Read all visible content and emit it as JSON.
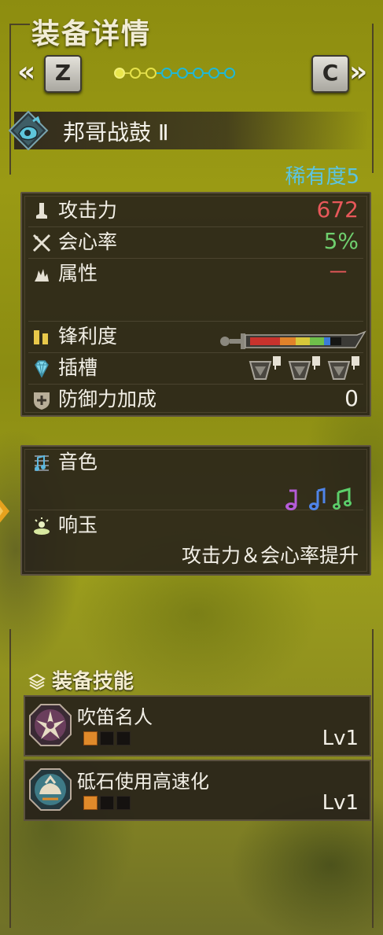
{
  "header": {
    "title": "装备详情",
    "prev_key": "Z",
    "next_key": "C",
    "prev_chevron": "«",
    "next_chevron": "»",
    "page_dots": [
      "filled",
      "yellow",
      "yellow",
      "blue",
      "blue",
      "blue",
      "blue",
      "blue"
    ]
  },
  "weapon": {
    "name": "邦哥战鼓 Ⅱ",
    "icon": "hunting-horn-icon",
    "rarity": "稀有度5"
  },
  "stats": {
    "attack_label": "攻击力",
    "attack_value": "672",
    "affinity_label": "会心率",
    "affinity_value": "5%",
    "element_label": "属性",
    "element_value": "－",
    "sharpness_label": "锋利度",
    "slots_label": "插槽",
    "defense_label": "防御力加成",
    "defense_value": "0",
    "colors": {
      "attack": "#e8585a",
      "affinity": "#6fcf6e",
      "element": "#e8585a"
    }
  },
  "horn": {
    "melody_label": "音色",
    "notes": [
      {
        "color": "#b55cd8",
        "icon": "purple-note-icon"
      },
      {
        "color": "#4f84e8",
        "icon": "blue-note-icon"
      },
      {
        "color": "#5ccf6a",
        "icon": "green-note-icon"
      }
    ],
    "echo_label": "响玉",
    "echo_value": "攻击力＆会心率提升"
  },
  "skills": {
    "title": "装备技能",
    "items": [
      {
        "name": "吹笛名人",
        "level": "Lv1",
        "pips_filled": 1,
        "pips_total": 3,
        "icon": "horn-maestro-icon"
      },
      {
        "name": "砥石使用高速化",
        "level": "Lv1",
        "pips_filled": 1,
        "pips_total": 3,
        "icon": "speed-sharpening-icon"
      }
    ]
  }
}
